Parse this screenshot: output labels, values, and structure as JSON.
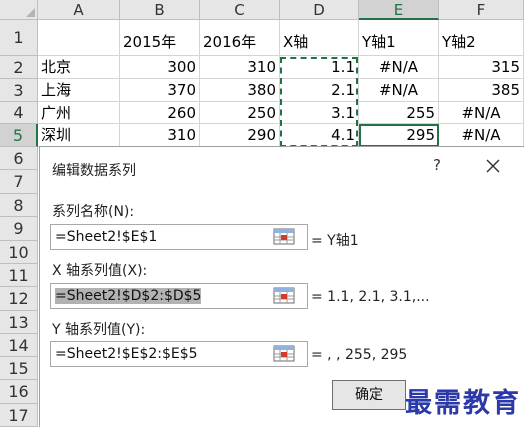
{
  "sheet": {
    "columns": [
      "A",
      "B",
      "C",
      "D",
      "E",
      "F"
    ],
    "rows": [
      "1",
      "2",
      "3",
      "4",
      "5",
      "6",
      "7",
      "8",
      "9",
      "10",
      "11",
      "12",
      "13",
      "14",
      "15",
      "16",
      "17"
    ],
    "cells": [
      [
        "",
        "2015年",
        "2016年",
        "X轴",
        "Y轴1",
        "Y轴2"
      ],
      [
        "北京",
        "300",
        "310",
        "1.1",
        "#N/A",
        "315"
      ],
      [
        "上海",
        "370",
        "380",
        "2.1",
        "#N/A",
        "385"
      ],
      [
        "广州",
        "260",
        "250",
        "3.1",
        "255",
        "#N/A"
      ],
      [
        "深圳",
        "310",
        "290",
        "4.1",
        "295",
        "#N/A"
      ]
    ]
  },
  "dialog": {
    "title": "编辑数据系列",
    "help": "?",
    "series_name_label": "系列名称(N):",
    "series_name_value": "=Sheet2!$E$1",
    "series_name_result": "= Y轴1",
    "x_values_label": "X 轴系列值(X):",
    "x_values_value": "=Sheet2!$D$2:$D$5",
    "x_values_result": "= 1.1, 2.1, 3.1,...",
    "y_values_label": "Y 轴系列值(Y):",
    "y_values_value": "=Sheet2!$E$2:$E$5",
    "y_values_result": "= , , 255, 295",
    "ok_label": "确定"
  },
  "watermark": "最需教育",
  "colors": {
    "accent": "#217346",
    "watermark": "#2b3aa8"
  }
}
